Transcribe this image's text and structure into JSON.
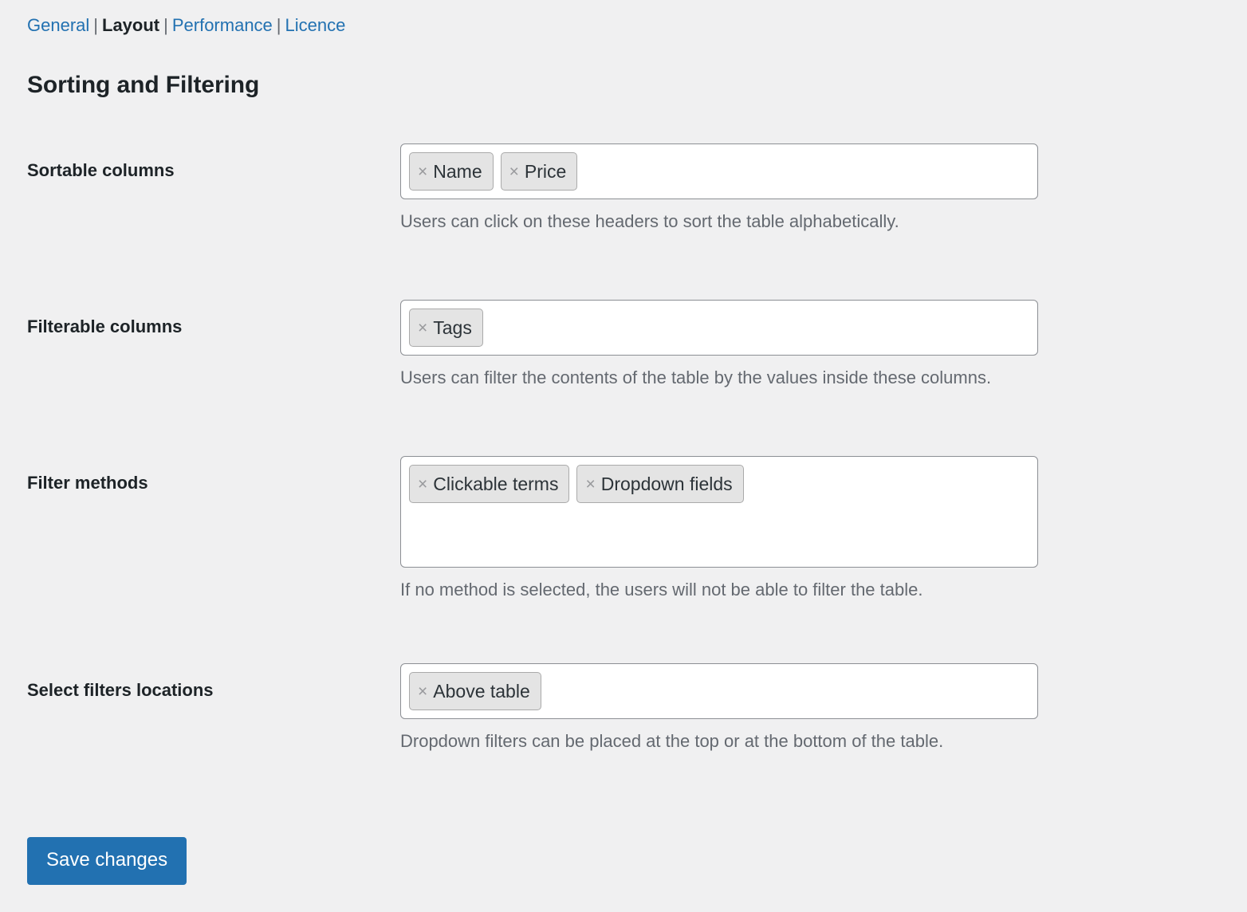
{
  "nav": {
    "separator": "|",
    "items": [
      {
        "label": "General",
        "current": false
      },
      {
        "label": "Layout",
        "current": true
      },
      {
        "label": "Performance",
        "current": false
      },
      {
        "label": "Licence",
        "current": false
      }
    ]
  },
  "page": {
    "title": "Sorting and Filtering"
  },
  "rows": [
    {
      "label": "Sortable columns",
      "tokens": [
        "Name",
        "Price"
      ],
      "help": "Users can click on these headers to sort the table alphabetically.",
      "remove_icon": "×"
    },
    {
      "label": "Filterable columns",
      "tokens": [
        "Tags"
      ],
      "help": "Users can filter the contents of the table by the values inside these columns.",
      "remove_icon": "×"
    },
    {
      "label": "Filter methods",
      "tokens": [
        "Clickable terms",
        "Dropdown fields"
      ],
      "help": "If no method is selected, the users will not be able to filter the table.",
      "remove_icon": "×"
    },
    {
      "label": "Select filters locations",
      "tokens": [
        "Above table"
      ],
      "help": "Dropdown filters can be placed at the top or at the bottom of the table.",
      "remove_icon": "×"
    }
  ],
  "submit": {
    "label": "Save changes"
  },
  "colors": {
    "background": "#f0f0f1",
    "link": "#2271b1",
    "heading": "#1d2327",
    "help": "#646970",
    "button": "#2271b1",
    "token_bg": "#e4e4e4",
    "token_border": "#aaaaaa",
    "input_border": "#8c8f94"
  }
}
